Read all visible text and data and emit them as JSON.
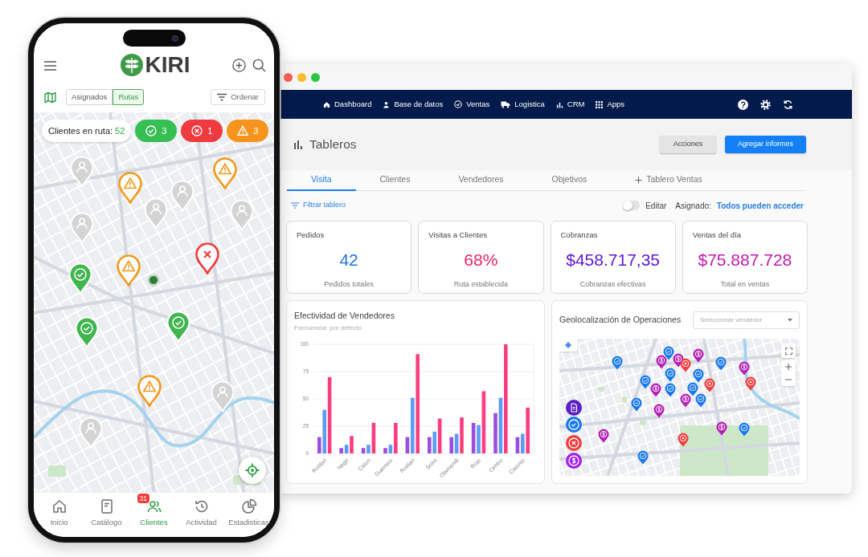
{
  "phone": {
    "logo": "KIRI",
    "view_tabs": [
      {
        "label": "Asignados",
        "selected": false
      },
      {
        "label": "Rutas",
        "selected": true
      }
    ],
    "sort_button": "Ordenar",
    "route_summary": {
      "label": "Clientes en ruta:",
      "count": "52"
    },
    "status_counts": [
      {
        "kind": "done",
        "count": "3"
      },
      {
        "kind": "failed",
        "count": "1"
      },
      {
        "kind": "warning",
        "count": "3"
      }
    ],
    "map_pins": [
      {
        "kind": "client"
      },
      {
        "kind": "warning"
      },
      {
        "kind": "warning"
      },
      {
        "kind": "client"
      },
      {
        "kind": "client"
      },
      {
        "kind": "client"
      },
      {
        "kind": "client"
      },
      {
        "kind": "failed"
      },
      {
        "kind": "warning"
      },
      {
        "kind": "done"
      },
      {
        "kind": "done"
      },
      {
        "kind": "done"
      },
      {
        "kind": "warning"
      },
      {
        "kind": "client"
      },
      {
        "kind": "client"
      }
    ],
    "bottom_nav": [
      {
        "label": "Inicio",
        "selected": false
      },
      {
        "label": "Catálogo",
        "selected": false
      },
      {
        "label": "Clientes",
        "selected": true,
        "badge": "31"
      },
      {
        "label": "Actividad",
        "selected": false
      },
      {
        "label": "Estadisticas",
        "selected": false
      }
    ]
  },
  "dashboard": {
    "nav": [
      "Dashboard",
      "Base de datos",
      "Ventas",
      "Logistica",
      "CRM",
      "Apps"
    ],
    "title": "Tableros",
    "actions": [
      {
        "label": "Acciones",
        "kind": "secondary"
      },
      {
        "label": "Agregar informes",
        "kind": "primary"
      }
    ],
    "tabs": [
      {
        "label": "Visita",
        "selected": true,
        "kind": "tab"
      },
      {
        "label": "Clientes",
        "selected": false,
        "kind": "tab"
      },
      {
        "label": "Vendedores",
        "selected": false,
        "kind": "tab"
      },
      {
        "label": "Objetivos",
        "selected": false,
        "kind": "tab"
      },
      {
        "label": "Tablero Ventas",
        "selected": false,
        "kind": "add"
      }
    ],
    "filter_link": "Filtrar tablero",
    "edit_toggle": {
      "label": "Editar",
      "on": false
    },
    "assigned": {
      "label": "Asignado:",
      "value": "Todos pueden acceder"
    },
    "kpis": [
      {
        "title": "Pedidos",
        "value": "42",
        "caption": "Pedidos totales",
        "color": "#1a73e8"
      },
      {
        "title": "Visitas a Clientes",
        "value": "68%",
        "caption": "Ruta establecida",
        "color": "#f0245e"
      },
      {
        "title": "Cobranzas",
        "value": "$458.717,35",
        "caption": "Cobranzas efectivas",
        "color": "#5b16d8"
      },
      {
        "title": "Ventas del día",
        "value": "$75.887.728",
        "caption": "Total en ventas",
        "color": "#c218b0"
      }
    ],
    "effectiveness": {
      "title": "Efectividad de Vendedores",
      "subtitle": "Frecuencia: por defecto",
      "chart_data": {
        "type": "bar",
        "categories": [
          "Roldan",
          "Negri",
          "Caton",
          "Guerrero",
          "Roldan",
          "Sosa",
          "Otamendi",
          "Rojo",
          "Centro",
          "Catonio"
        ],
        "series": [
          {
            "color": "#9b4de0",
            "values": [
              15,
              5,
              5,
              5,
              15,
              15,
              15,
              28,
              37,
              15
            ]
          },
          {
            "color": "#5c9cf6",
            "values": [
              40,
              8,
              8,
              8,
              51,
              20,
              18,
              26,
              51,
              18
            ]
          },
          {
            "color": "#ff3d7f",
            "values": [
              70,
              16,
              28,
              28,
              91,
              32,
              33,
              57,
              100,
              42
            ]
          }
        ],
        "ylim": [
          0,
          100
        ],
        "yticks": [
          0,
          25,
          50,
          75,
          100
        ],
        "grid": true
      }
    },
    "geolocation": {
      "title": "Geolocalización de Operaciones",
      "vendor_select": {
        "placeholder": "Seleccionar vendedor"
      },
      "legend": [
        {
          "kind": "document"
        },
        {
          "kind": "check"
        },
        {
          "kind": "failed"
        },
        {
          "kind": "payment"
        }
      ],
      "markers": [
        {
          "kind": "check"
        },
        {
          "kind": "check"
        },
        {
          "kind": "payment"
        },
        {
          "kind": "payment"
        },
        {
          "kind": "failed"
        },
        {
          "kind": "payment"
        },
        {
          "kind": "check"
        },
        {
          "kind": "payment"
        },
        {
          "kind": "check"
        },
        {
          "kind": "check"
        },
        {
          "kind": "check"
        },
        {
          "kind": "payment"
        },
        {
          "kind": "check"
        },
        {
          "kind": "check"
        },
        {
          "kind": "failed"
        },
        {
          "kind": "failed"
        },
        {
          "kind": "payment"
        },
        {
          "kind": "check"
        },
        {
          "kind": "check"
        },
        {
          "kind": "payment"
        },
        {
          "kind": "payment"
        },
        {
          "kind": "check"
        },
        {
          "kind": "payment"
        },
        {
          "kind": "failed"
        },
        {
          "kind": "check"
        }
      ]
    }
  }
}
